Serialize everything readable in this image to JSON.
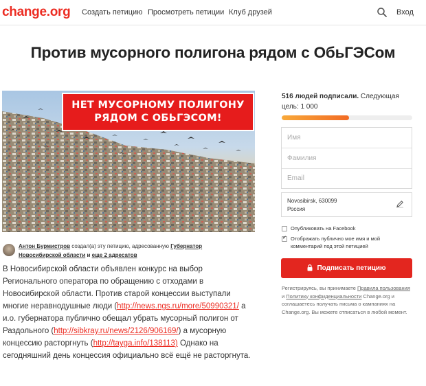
{
  "header": {
    "logo": "change.org",
    "nav": [
      "Создать петицию",
      "Просмотреть петиции",
      "Клуб друзей"
    ],
    "search_icon": "search-icon",
    "login": "Вход"
  },
  "petition": {
    "title": "Против мусорного полигона рядом с ОбьГЭСом",
    "banner_line1": "НЕТ МУСОРНОМУ ПОЛИГОНУ",
    "banner_line2": "РЯДОМ С ОБЬГЭСОМ!"
  },
  "author": {
    "name": "Антон Бурмистров",
    "created": "создал(а) эту петицию, адресованную",
    "target": "Губернатор Новосибирской области",
    "and": "и",
    "more": "еще 2 адресатов"
  },
  "body": {
    "p1": "В Новосибирской области объявлен конкурс на выбор Регионального оператора по обращению с отходами в Новосибирской области. Против старой концессии выступали многие неравнодушные люди (",
    "link1": "http://news.ngs.ru/more/50990321/",
    "p2": " а и.о. губернатора публично обещал убрать мусорный полигон от Раздольного (",
    "link2": "http://sibkray.ru/news/2126/906169/",
    "p3": ") а мусорную концессию расторгнуть (",
    "link3": "http://tayga.info/138113)",
    "p4": " Однако на сегодняшний день концессия официально всё ещё не расторгнута."
  },
  "sidebar": {
    "count": "516 людей подписали.",
    "goal": "Следующая цель: 1 000",
    "progress": 0.516,
    "name_placeholder": "Имя",
    "surname_placeholder": "Фамилия",
    "email_placeholder": "Email",
    "address_line1": "Novosibirsk, 630099",
    "address_line2": "Россия",
    "facebook_label": "Опубликовать на Facebook",
    "facebook_checked": false,
    "public_label": "Отображать публично мое имя и мой комментарий под этой петицией",
    "public_checked": true,
    "sign_button": "Подписать петицию",
    "legal_1": "Регистрируясь, вы принимаете ",
    "legal_terms": "Правила пользования",
    "legal_2": " и ",
    "legal_privacy": "Политику конфиденциальности",
    "legal_3": " Change.org и соглашаетесь получать письма о кампаниях на Change.org. Вы можете отписаться в любой момент."
  },
  "colors": {
    "brand": "#ec2c22",
    "button": "#e3261f",
    "progress_start": "#f8a93a",
    "progress_end": "#f26b24"
  }
}
